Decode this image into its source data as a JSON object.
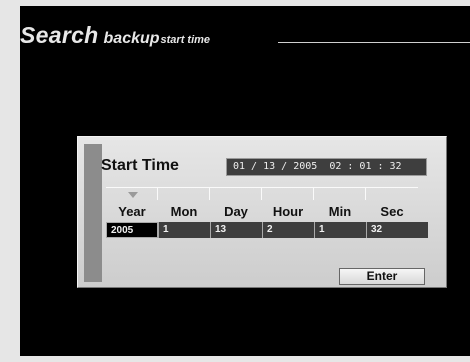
{
  "header": {
    "title_main": "Search",
    "title_sub1": "backup",
    "title_sub2": "start time"
  },
  "panel": {
    "label": "Start Time",
    "datetime_display": "01 / 13 / 2005  02 : 01 : 32",
    "columns": [
      "Year",
      "Mon",
      "Day",
      "Hour",
      "Min",
      "Sec"
    ],
    "values": [
      "2005",
      "1",
      "13",
      "2",
      "1",
      "32"
    ],
    "selected_column": "Year",
    "enter_label": "Enter"
  }
}
